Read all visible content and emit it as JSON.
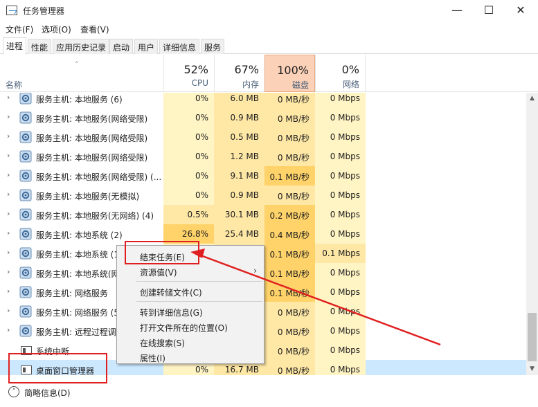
{
  "window": {
    "title": "任务管理器",
    "minimize": "—",
    "maximize": "☐",
    "close": "✕"
  },
  "menu": [
    "文件(F)",
    "选项(O)",
    "查看(V)"
  ],
  "tabs": [
    "进程",
    "性能",
    "应用历史记录",
    "启动",
    "用户",
    "详细信息",
    "服务"
  ],
  "header": {
    "name": "名称",
    "cpu": {
      "pct": "52%",
      "label": "CPU"
    },
    "mem": {
      "pct": "67%",
      "label": "内存"
    },
    "disk": {
      "pct": "100%",
      "label": "磁盘"
    },
    "net": {
      "pct": "0%",
      "label": "网络"
    }
  },
  "rows": [
    {
      "name": "服务主机: 本地服务 (6)",
      "cpu": "0%",
      "mem": "6.0 MB",
      "disk": "0 MB/秒",
      "net": "0 Mbps"
    },
    {
      "name": "服务主机: 本地服务(网络受限)",
      "cpu": "0%",
      "mem": "0.9 MB",
      "disk": "0 MB/秒",
      "net": "0 Mbps"
    },
    {
      "name": "服务主机: 本地服务(网络受限)",
      "cpu": "0%",
      "mem": "0.5 MB",
      "disk": "0 MB/秒",
      "net": "0 Mbps"
    },
    {
      "name": "服务主机: 本地服务(网络受限)",
      "cpu": "0%",
      "mem": "1.2 MB",
      "disk": "0 MB/秒",
      "net": "0 Mbps"
    },
    {
      "name": "服务主机: 本地服务(网络受限) (...",
      "cpu": "0%",
      "mem": "9.1 MB",
      "disk": "0.1 MB/秒",
      "net": "0 Mbps"
    },
    {
      "name": "服务主机: 本地服务(无模拟)",
      "cpu": "0%",
      "mem": "0.9 MB",
      "disk": "0 MB/秒",
      "net": "0 Mbps"
    },
    {
      "name": "服务主机: 本地服务(无网络) (4)",
      "cpu": "0.5%",
      "mem": "30.1 MB",
      "disk": "0.2 MB/秒",
      "net": "0 Mbps"
    },
    {
      "name": "服务主机: 本地系统 (2)",
      "cpu": "26.8%",
      "mem": "25.4 MB",
      "disk": "0.4 MB/秒",
      "net": "0 Mbps"
    },
    {
      "name": "服务主机: 本地系统 (1",
      "cpu": "",
      "mem": "",
      "disk": "0.1 MB/秒",
      "net": "0.1 Mbps"
    },
    {
      "name": "服务主机: 本地系统(网",
      "cpu": "",
      "mem": "",
      "disk": "0.1 MB/秒",
      "net": "0 Mbps"
    },
    {
      "name": "服务主机: 网络服务",
      "cpu": "",
      "mem": "",
      "disk": "0.1 MB/秒",
      "net": "0 Mbps"
    },
    {
      "name": "服务主机: 网络服务 (5",
      "cpu": "",
      "mem": "",
      "disk": "0 MB/秒",
      "net": "0 Mbps"
    },
    {
      "name": "服务主机: 远程过程调",
      "cpu": "",
      "mem": "",
      "disk": "0 MB/秒",
      "net": "0 Mbps"
    },
    {
      "name": "系统中断",
      "cpu": "",
      "mem": "",
      "disk": "0 MB/秒",
      "net": "0 Mbps"
    },
    {
      "name": "桌面窗口管理器",
      "cpu": "0%",
      "mem": "16.7 MB",
      "disk": "0 MB/秒",
      "net": "0 Mbps"
    }
  ],
  "context_menu": {
    "end_task": "结束任务(E)",
    "resource_values": "资源值(V)",
    "create_dump": "创建转储文件(C)",
    "go_to_details": "转到详细信息(G)",
    "open_location": "打开文件所在的位置(O)",
    "search_online": "在线搜索(S)",
    "properties": "属性(I)",
    "submenu_arrow": "›"
  },
  "footer": {
    "label": "简略信息(D)",
    "icon": "chevron-up-icon"
  },
  "colors": {
    "heat_light": "#fff4c4",
    "heat_mid": "#ffe8a6",
    "heat_strong": "#ffd36a",
    "disk_col": "#ffe8a6",
    "disk_header": "#fbd1b8",
    "selection": "#cce8ff",
    "annotation_red": "#e02020"
  }
}
